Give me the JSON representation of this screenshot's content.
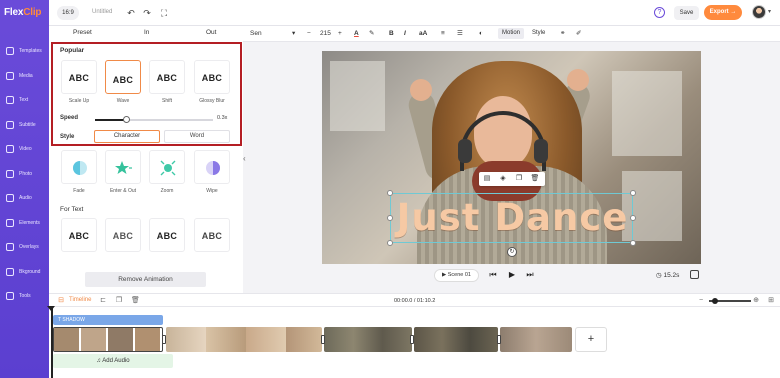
{
  "app": {
    "logo_prefix": "Flex",
    "logo_suffix": "Clip",
    "aspect_ratio": "16:9",
    "project_title": "Untitled",
    "help": "?",
    "save_label": "Save",
    "export_label": "Export →",
    "brand_color": "#6a4bd9",
    "accent_color": "#ff8a3d"
  },
  "sidebar": {
    "items": [
      {
        "label": "Templates",
        "icon": "templates-icon"
      },
      {
        "label": "Media",
        "icon": "media-icon"
      },
      {
        "label": "Text",
        "icon": "text-icon"
      },
      {
        "label": "Subtitle",
        "icon": "subtitle-icon"
      },
      {
        "label": "Video",
        "icon": "video-icon"
      },
      {
        "label": "Photo",
        "icon": "photo-icon"
      },
      {
        "label": "Audio",
        "icon": "audio-icon"
      },
      {
        "label": "Elements",
        "icon": "elements-icon"
      },
      {
        "label": "Overlays",
        "icon": "overlays-icon"
      },
      {
        "label": "Bkground",
        "icon": "background-icon"
      },
      {
        "label": "Tools",
        "icon": "tools-icon"
      }
    ]
  },
  "panel": {
    "tabs": [
      "Preset",
      "In",
      "Out"
    ],
    "popular_title": "Popular",
    "popular": [
      {
        "label": "Scale Up",
        "preview": "ABC"
      },
      {
        "label": "Wave",
        "preview": "ABC",
        "selected": true
      },
      {
        "label": "Shift",
        "preview": "ABC"
      },
      {
        "label": "Glossy Blur",
        "preview": "ABC"
      }
    ],
    "speed_label": "Speed",
    "speed_value": "0.3x",
    "speed_fraction": 0.27,
    "style_label": "Style",
    "style_options": [
      "Character",
      "Word"
    ],
    "style_selected": "Character",
    "general": [
      {
        "label": "Fade"
      },
      {
        "label": "Enter & Out"
      },
      {
        "label": "Zoom"
      },
      {
        "label": "Wipe"
      }
    ],
    "for_text_title": "For Text",
    "for_text": [
      {
        "preview": "ABC"
      },
      {
        "preview": "ABC"
      },
      {
        "preview": "ABC"
      },
      {
        "preview": "ABC"
      }
    ],
    "remove_label": "Remove Animation"
  },
  "text_toolbar": {
    "font": "Sen",
    "size": "215",
    "size_minus": "−",
    "size_plus": "+",
    "motion_label": "Motion",
    "style_label": "Style"
  },
  "canvas": {
    "text": "Just Dance"
  },
  "playback": {
    "scene_label": "Scene 01",
    "duration": "15.2s"
  },
  "timeline": {
    "label": "Timeline",
    "time": "00:00.0 / 01:10.2",
    "shadow_label": "SHADOW",
    "add_audio_label": "Add Audio",
    "add_clip": "+"
  }
}
